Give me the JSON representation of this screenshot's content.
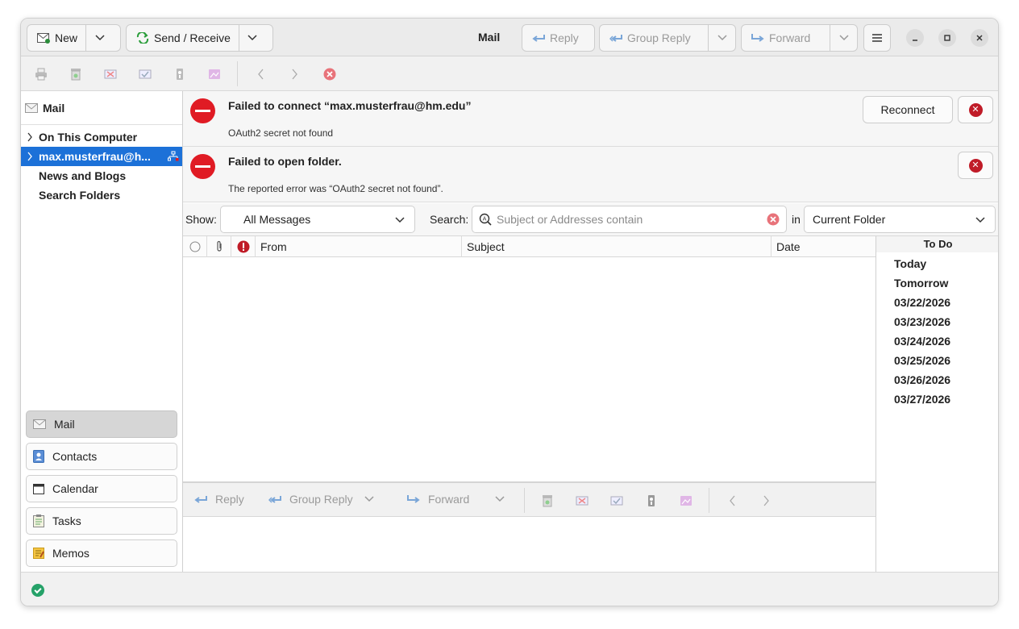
{
  "header": {
    "new_label": "New",
    "send_receive_label": "Send / Receive",
    "title": "Mail",
    "reply_label": "Reply",
    "group_reply_label": "Group Reply",
    "forward_label": "Forward"
  },
  "sidebar": {
    "title": "Mail",
    "folders": [
      "On This Computer",
      "max.musterfrau@h...",
      "News and Blogs",
      "Search Folders"
    ],
    "switcher": [
      "Mail",
      "Contacts",
      "Calendar",
      "Tasks",
      "Memos"
    ]
  },
  "alerts": [
    {
      "title": "Failed to connect “max.musterfrau@hm.edu”",
      "detail": "OAuth2 secret not found",
      "button": "Reconnect"
    },
    {
      "title": "Failed to open folder.",
      "detail": "The reported error was “OAuth2 secret not found”."
    }
  ],
  "filter": {
    "show_label": "Show:",
    "show_value": "All Messages",
    "search_label": "Search:",
    "search_placeholder": "Subject or Addresses contain",
    "in_label": "in",
    "scope_value": "Current Folder"
  },
  "columns": [
    "From",
    "Subject",
    "Date"
  ],
  "todo": {
    "title": "To Do",
    "items": [
      "Today",
      "Tomorrow",
      "03/22/2026",
      "03/23/2026",
      "03/24/2026",
      "03/25/2026",
      "03/26/2026",
      "03/27/2026"
    ]
  },
  "preview_toolbar": {
    "reply_label": "Reply",
    "group_reply_label": "Group Reply",
    "forward_label": "Forward"
  },
  "colors": {
    "accent": "#1c71d8",
    "error": "#e01b24",
    "ok": "#26a269"
  }
}
